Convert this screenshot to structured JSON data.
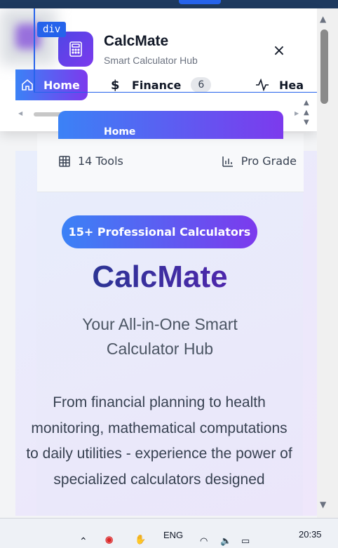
{
  "app": {
    "name": "CalcMate",
    "tagline": "Smart Calculator Hub"
  },
  "drawer": {
    "close_label": "×",
    "debug_tag": "div",
    "nav": [
      {
        "label": "Home",
        "icon": "home-icon",
        "active": true
      },
      {
        "label": "Finance",
        "icon": "dollar-icon",
        "count": "6"
      },
      {
        "label": "Hea",
        "icon": "activity-icon"
      }
    ],
    "peek_label": "Home"
  },
  "stats": {
    "tools": "14 Tools",
    "grade": "Pro Grade"
  },
  "hero": {
    "badge": "15+ Professional Calculators",
    "title": "CalcMate",
    "subtitle": "Your All-in-One Smart Calculator Hub",
    "description": "From financial planning to health monitoring, mathematical computations to daily utilities - experience the power of specialized calculators designed"
  },
  "taskbar": {
    "lang": "ENG",
    "time": "20:35"
  },
  "colors": {
    "accent_start": "#3b82f6",
    "accent_end": "#7c3aed",
    "title_start": "#1e3a8a",
    "title_end": "#5b21b6"
  }
}
